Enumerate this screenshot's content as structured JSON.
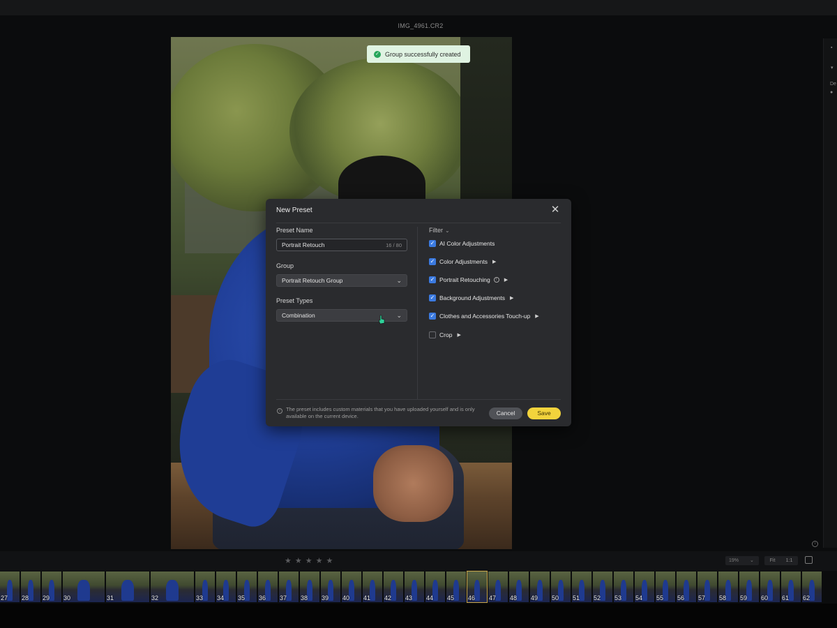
{
  "window": {
    "filename": "IMG_4961.CR2"
  },
  "toast": {
    "message": "Group successfully created"
  },
  "dialog": {
    "title": "New Preset",
    "preset_name": {
      "label": "Preset Name",
      "value": "Portrait Retouch",
      "counter": "16 / 80"
    },
    "group": {
      "label": "Group",
      "value": "Portrait Retouch Group"
    },
    "preset_types": {
      "label": "Preset Types",
      "value": "Combination"
    },
    "filter": {
      "label": "Filter",
      "options": [
        {
          "label": "AI Color Adjustments",
          "checked": true
        },
        {
          "label": "Color Adjustments",
          "checked": true
        },
        {
          "label": "Portrait Retouching",
          "checked": true
        },
        {
          "label": "Background Adjustments",
          "checked": true
        },
        {
          "label": "Clothes and Accessories Touch-up",
          "checked": true
        },
        {
          "label": "Crop",
          "checked": false
        }
      ]
    },
    "note": "The preset includes custom materials that you have uploaded yourself and is only available on the current device.",
    "cancel_label": "Cancel",
    "save_label": "Save"
  },
  "toolbar": {
    "zoom": "19%",
    "fit_label": "Fit",
    "one_to_one_label": "1:1",
    "rating_max": 5
  },
  "filmstrip": {
    "frames": [
      "27",
      "28",
      "29",
      "30",
      "31",
      "32",
      "33",
      "34",
      "35",
      "36",
      "37",
      "38",
      "39",
      "40",
      "41",
      "42",
      "43",
      "44",
      "45",
      "46",
      "47",
      "48",
      "49",
      "50",
      "51",
      "52",
      "53",
      "54",
      "55",
      "56",
      "57",
      "58",
      "59",
      "60",
      "61",
      "62"
    ],
    "selected": "46"
  },
  "colors": {
    "accent_save": "#f2d33c",
    "checkbox": "#3b7ae0",
    "toast_bg": "#dff3e2",
    "success": "#26a65b"
  }
}
